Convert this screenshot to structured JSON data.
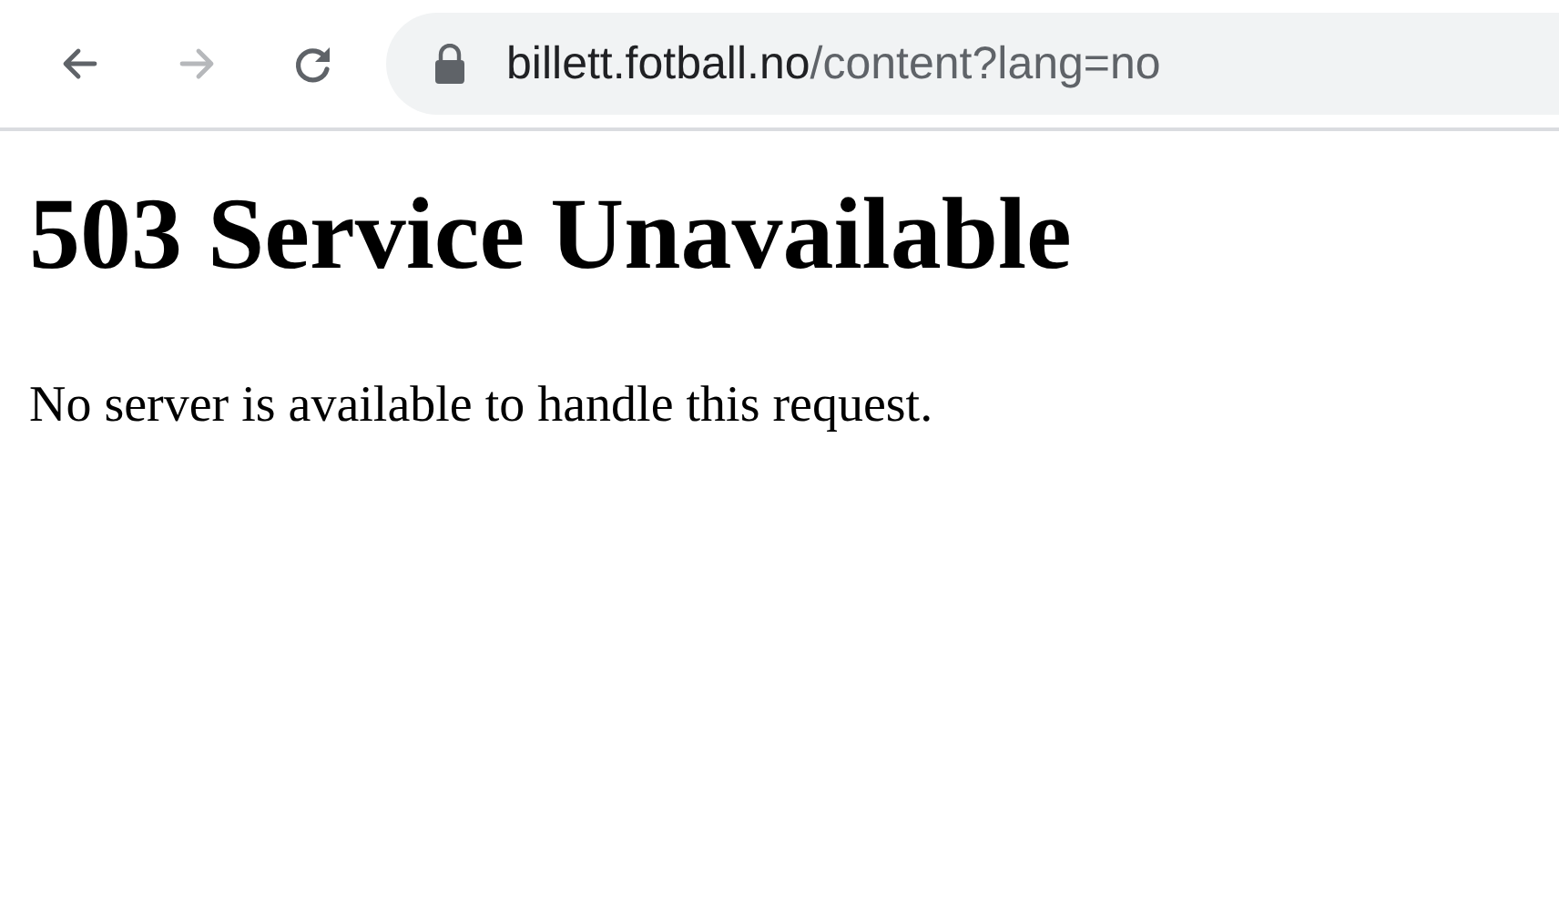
{
  "toolbar": {
    "buttons": [
      {
        "kind": "back",
        "disabled": false
      },
      {
        "kind": "forward",
        "disabled": true
      },
      {
        "kind": "reload",
        "disabled": false
      }
    ],
    "address": {
      "host": "billett.fotball.no",
      "path": "/content?lang=no"
    }
  },
  "page": {
    "heading": "503 Service Unavailable",
    "message": "No server is available to handle this request."
  }
}
